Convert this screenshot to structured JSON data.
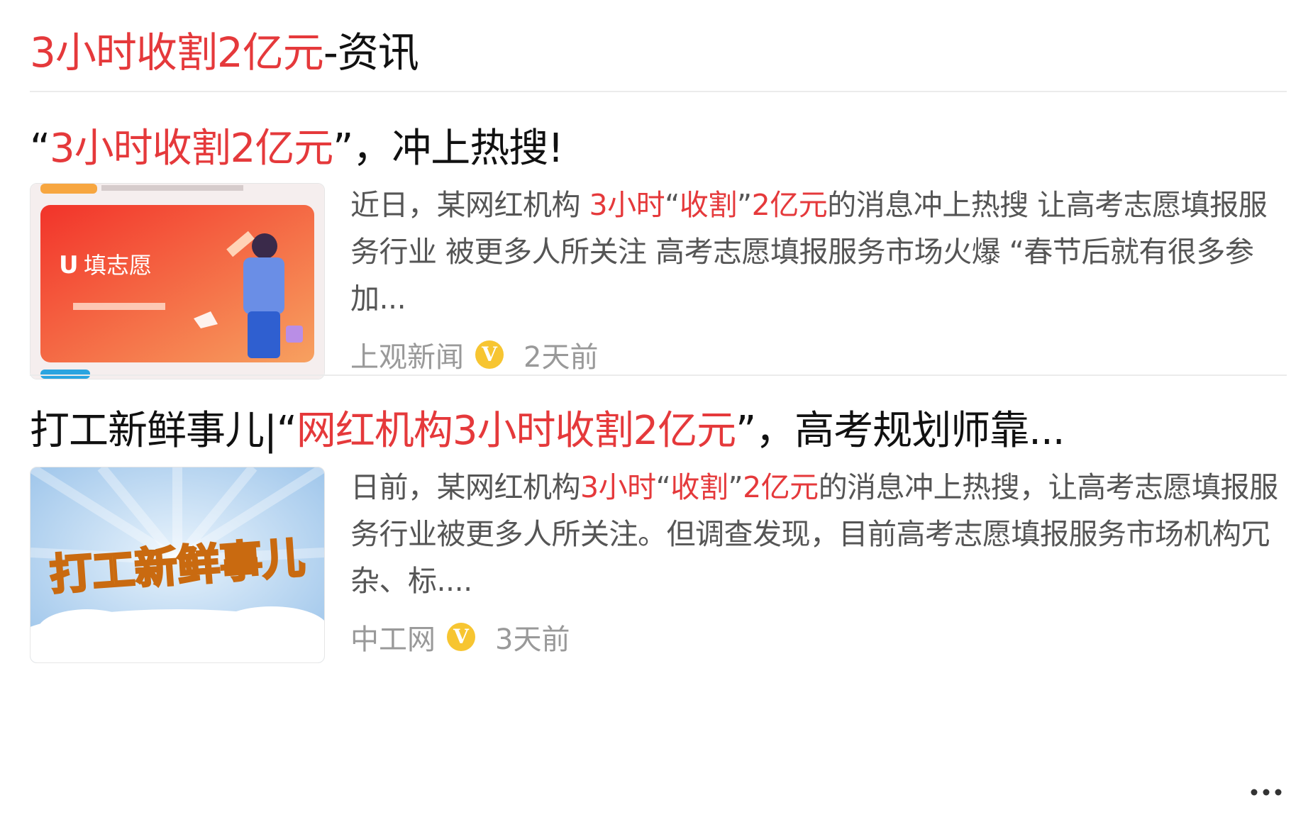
{
  "header": {
    "title_highlight": "3小时收割2亿元",
    "title_suffix": "-资讯"
  },
  "articles": [
    {
      "title_prefix": "“",
      "title_highlight": "3小时收割2亿元",
      "title_suffix": "”，冲上热搜!",
      "summary_pre": "近日，某网红机构 ",
      "summary_hl1": "3小时",
      "summary_mid1": "“",
      "summary_hl2": "收割",
      "summary_mid2": "”",
      "summary_hl3": "2亿元",
      "summary_post": "的消息冲上热搜 让高考志愿填报服务行业 被更多人所关注 高考志愿填报服务市场火爆 “春节后就有很多参加...",
      "source": "上观新闻",
      "verified_badge": "V",
      "time": "2天前",
      "thumb_text": "填志愿",
      "thumb_bg": "#f04a30",
      "icon": "article-thumbnail"
    },
    {
      "title_prefix": "打工新鲜事儿|“",
      "title_highlight": "网红机构3小时收割2亿元",
      "title_suffix": "”，高考规划师靠...",
      "summary_pre": "日前，某网红机构",
      "summary_hl1": "3小时",
      "summary_mid1": "“",
      "summary_hl2": "收割",
      "summary_mid2": "”",
      "summary_hl3": "2亿元",
      "summary_post": "的消息冲上热搜，让高考志愿填报服务行业被更多人所关注。但调查发现，目前高考志愿填报服务市场机构冗杂、标....",
      "source": "中工网",
      "verified_badge": "V",
      "time": "3天前",
      "thumb_text": "打工新鲜事儿",
      "thumb_bg": "#a9cdee",
      "icon": "article-thumbnail"
    }
  ],
  "more_icon": "more-dots-icon",
  "colors": {
    "highlight": "#e5393b",
    "muted": "#999999",
    "badge": "#f7c531"
  }
}
